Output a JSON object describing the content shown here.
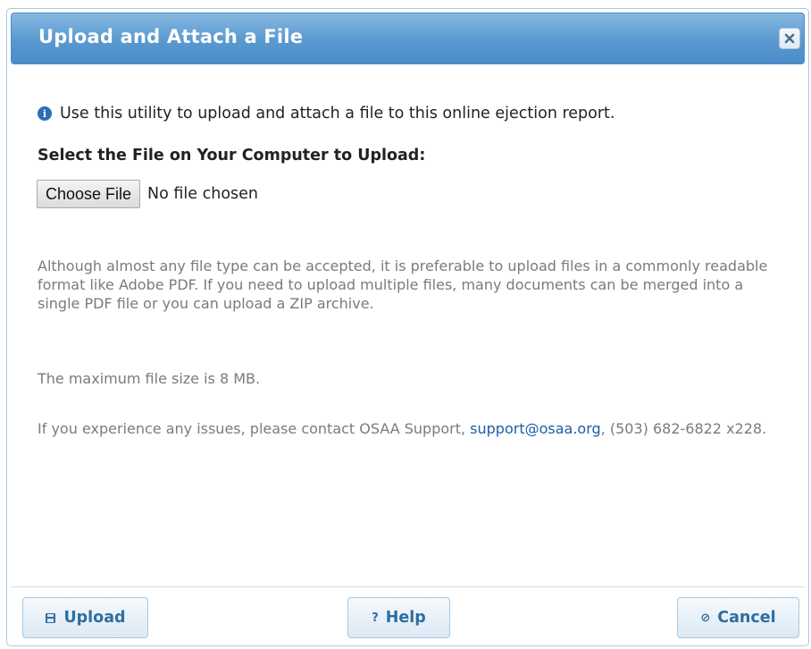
{
  "dialog": {
    "title": "Upload and Attach a File",
    "close_icon": "close-icon"
  },
  "info": {
    "icon": "info-icon",
    "icon_glyph": "i",
    "text": "Use this utility to upload and attach a file to this online ejection report."
  },
  "file_select": {
    "label": "Select the File on Your Computer to Upload:",
    "button_label": "Choose File",
    "status": "No file chosen"
  },
  "notes": {
    "p1": "Although almost any file type can be accepted, it is preferable to upload files in a commonly readable format like Adobe PDF. If you need to upload multiple files, many documents can be merged into a single PDF file or you can upload a ZIP archive.",
    "p2": "The maximum file size is 8 MB.",
    "p3_prefix": "If you experience any issues, please contact OSAA Support, ",
    "p3_link": "support@osaa.org",
    "p3_suffix": ", (503) 682-6822 x228."
  },
  "buttons": {
    "upload": {
      "label": "Upload",
      "icon": "save-icon"
    },
    "help": {
      "label": "Help",
      "icon": "question-icon",
      "glyph": "?"
    },
    "cancel": {
      "label": "Cancel",
      "icon": "cancel-icon",
      "glyph": "⊘"
    }
  },
  "colors": {
    "title_bar": "#5a99d0",
    "link": "#1a5fa6",
    "button_text": "#2e6e9e"
  }
}
